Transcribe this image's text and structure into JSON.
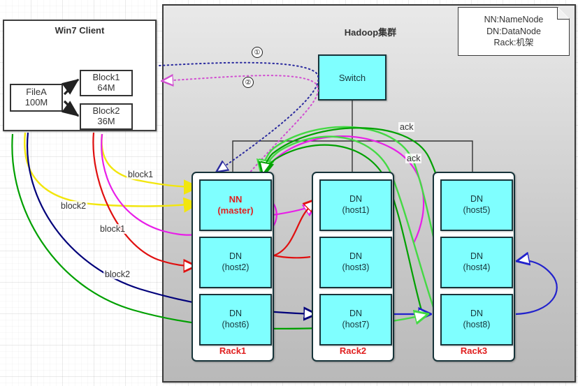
{
  "client": {
    "title": "Win7 Client",
    "file": {
      "name": "FileA",
      "size": "100M"
    },
    "blocks": [
      {
        "name": "Block1",
        "size": "64M"
      },
      {
        "name": "Block2",
        "size": "36M"
      }
    ]
  },
  "cluster": {
    "title": "Hadoop集群",
    "switch_label": "Switch",
    "racks": [
      {
        "label": "Rack1",
        "nodes": [
          {
            "line1": "NN",
            "line2": "(master)",
            "role": "master"
          },
          {
            "line1": "DN",
            "line2": "(host2)",
            "role": "datanode"
          },
          {
            "line1": "DN",
            "line2": "(host6)",
            "role": "datanode"
          }
        ]
      },
      {
        "label": "Rack2",
        "nodes": [
          {
            "line1": "DN",
            "line2": "(host1)",
            "role": "datanode"
          },
          {
            "line1": "DN",
            "line2": "(host3)",
            "role": "datanode"
          },
          {
            "line1": "DN",
            "line2": "(host7)",
            "role": "datanode"
          }
        ]
      },
      {
        "label": "Rack3",
        "nodes": [
          {
            "line1": "DN",
            "line2": "(host5)",
            "role": "datanode"
          },
          {
            "line1": "DN",
            "line2": "(host4)",
            "role": "datanode"
          },
          {
            "line1": "DN",
            "line2": "(host8)",
            "role": "datanode"
          }
        ]
      }
    ]
  },
  "legend": {
    "lines": [
      "NN:NameNode",
      "DN:DataNode",
      "Rack:机架"
    ]
  },
  "annotations": {
    "step1": "①",
    "step2": "②",
    "block_labels": [
      "block1",
      "block2",
      "block1",
      "block2"
    ],
    "ack_labels": [
      "ack",
      "ack"
    ]
  },
  "colors": {
    "node_fill": "#7FFFFF",
    "node_stroke": "#17343a",
    "accent_red": "#e02020",
    "panel_gray": "#c9c9c9",
    "edge_request": "#2a2a9e",
    "edge_response": "#d14fd1",
    "edge_yellow": "#f2e60d",
    "edge_magenta": "#e81ee8",
    "edge_red": "#e01010",
    "edge_navy": "#00007a",
    "edge_green": "#00a000",
    "edge_lightgreen": "#44d944",
    "edge_blue": "#2222cc"
  }
}
